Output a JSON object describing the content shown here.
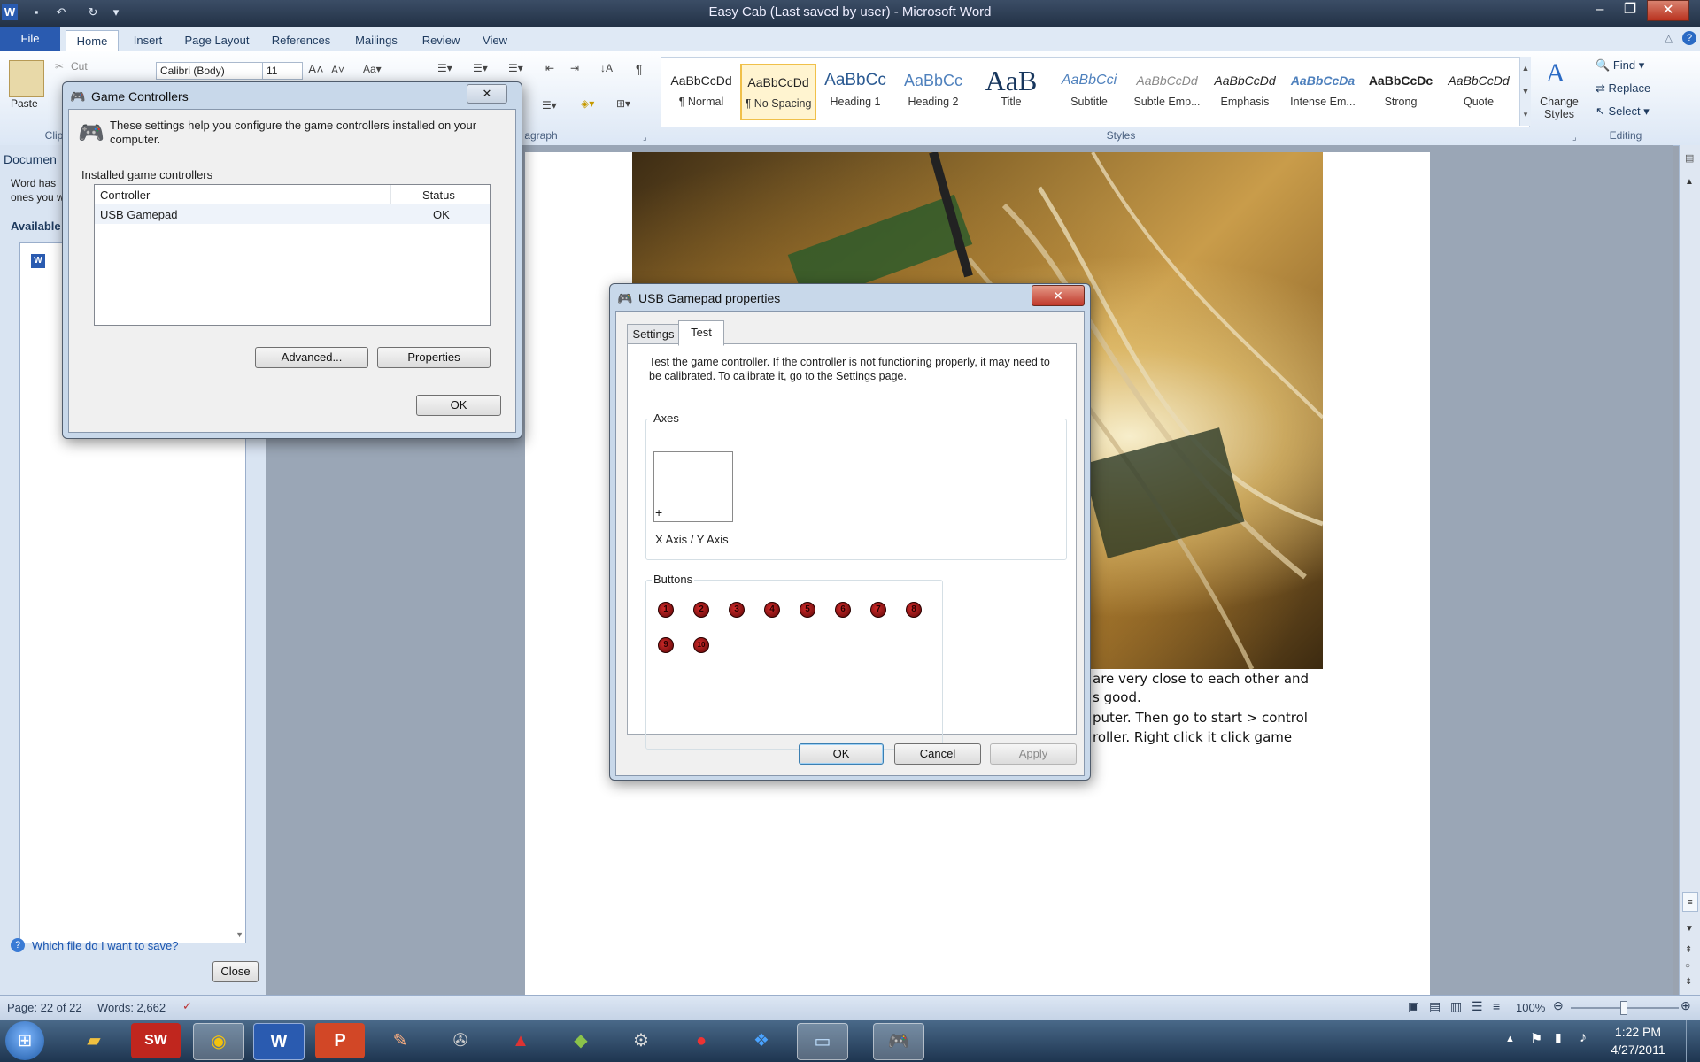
{
  "window": {
    "title": "Easy Cab (Last saved by user)  -  Microsoft Word"
  },
  "ribbon": {
    "tabs": [
      "File",
      "Home",
      "Insert",
      "Page Layout",
      "References",
      "Mailings",
      "Review",
      "View"
    ],
    "clipboard": {
      "paste": "Paste",
      "cut": "Cut",
      "group": "Clip"
    },
    "font": {
      "name": "Calibri (Body)",
      "size": "11"
    },
    "paragraph_group": "agraph",
    "styles_group": "Styles",
    "styles": [
      {
        "sample": "AaBbCcDd",
        "name": "¶ Normal"
      },
      {
        "sample": "AaBbCcDd",
        "name": "¶ No Spacing"
      },
      {
        "sample": "AaBbCc",
        "name": "Heading 1"
      },
      {
        "sample": "AaBbCc",
        "name": "Heading 2"
      },
      {
        "sample": "AaB",
        "name": "Title"
      },
      {
        "sample": "AaBbCci",
        "name": "Subtitle"
      },
      {
        "sample": "AaBbCcDd",
        "name": "Subtle Emp..."
      },
      {
        "sample": "AaBbCcDd",
        "name": "Emphasis"
      },
      {
        "sample": "AaBbCcDa",
        "name": "Intense Em..."
      },
      {
        "sample": "AaBbCcDc",
        "name": "Strong"
      },
      {
        "sample": "AaBbCcDd",
        "name": "Quote"
      }
    ],
    "change_styles": "Change Styles",
    "editing": {
      "find": "Find",
      "replace": "Replace",
      "select": "Select",
      "group": "Editing"
    }
  },
  "navpane": {
    "title": "Documen",
    "desc1": "Word has",
    "desc2": "ones you w",
    "available": "Available",
    "help_link": "Which file do I want to save?",
    "close": "Close"
  },
  "document": {
    "line1": "are very close to each other and",
    "line2": "s good.",
    "line3": "puter.  Then go to start > control",
    "line4": "roller.  Right click it click game"
  },
  "game_controllers": {
    "title": "Game Controllers",
    "intro": "These settings help you configure the game controllers installed on your computer.",
    "installed_label": "Installed game controllers",
    "columns": [
      "Controller",
      "Status"
    ],
    "rows": [
      {
        "controller": "USB Gamepad",
        "status": "OK"
      }
    ],
    "advanced": "Advanced...",
    "properties": "Properties",
    "ok": "OK"
  },
  "gamepad_props": {
    "title": "USB Gamepad  properties",
    "tabs": [
      "Settings",
      "Test"
    ],
    "description": "Test the game controller.  If the controller is not functioning properly, it may need to be calibrated.  To calibrate it, go to the Settings page.",
    "axes_label": "Axes",
    "axis_caption": "X Axis / Y Axis",
    "crosshair": "+",
    "buttons_label": "Buttons",
    "buttons": [
      "1",
      "2",
      "3",
      "4",
      "5",
      "6",
      "7",
      "8",
      "9",
      "10"
    ],
    "ok": "OK",
    "cancel": "Cancel",
    "apply": "Apply"
  },
  "statusbar": {
    "page": "Page: 22 of 22",
    "words": "Words: 2,662",
    "zoom": "100%"
  },
  "taskbar": {
    "time": "1:22 PM",
    "date": "4/27/2011"
  }
}
